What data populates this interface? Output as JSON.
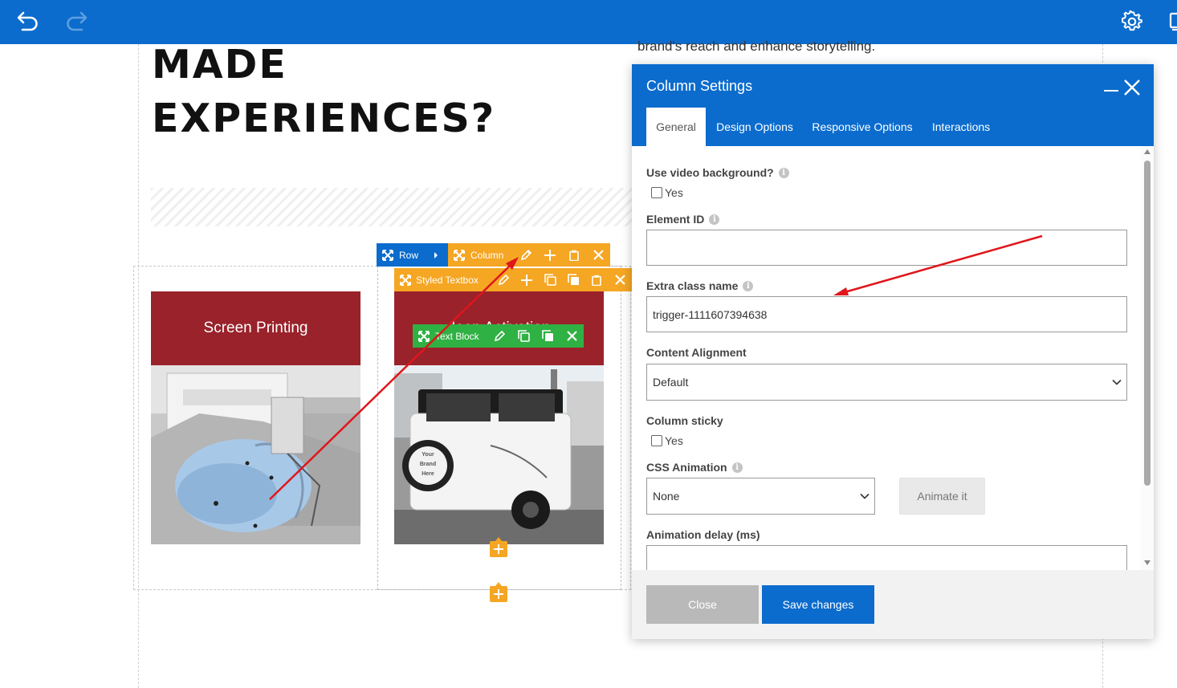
{
  "toolbar": {
    "undo_icon": "undo-icon",
    "redo_icon": "redo-icon",
    "settings_icon": "gear-icon"
  },
  "page": {
    "body_text": "brand's reach and enhance storytelling.",
    "heading_line1": "MADE",
    "heading_line2": "EXPERIENCES?",
    "cards": [
      {
        "title": "Screen Printing"
      },
      {
        "title": "Jeep Activation"
      }
    ],
    "jeep_tire_text": "Your Brand Here"
  },
  "builder": {
    "row_label": "Row",
    "column_label": "Column",
    "styled_textbox_label": "Styled Textbox",
    "text_block_label": "Text Block",
    "colors": {
      "row": "#0b6ccd",
      "column": "#f5a623",
      "text_block": "#2fb143"
    }
  },
  "modal": {
    "title": "Column Settings",
    "tabs": [
      {
        "label": "General",
        "active": true
      },
      {
        "label": "Design Options",
        "active": false
      },
      {
        "label": "Responsive Options",
        "active": false
      },
      {
        "label": "Interactions",
        "active": false
      }
    ],
    "fields": {
      "video_bg_label": "Use video background?",
      "video_bg_option": "Yes",
      "element_id_label": "Element ID",
      "element_id_value": "",
      "extra_class_label": "Extra class name",
      "extra_class_value": "trigger-1111607394638",
      "content_alignment_label": "Content Alignment",
      "content_alignment_value": "Default",
      "column_sticky_label": "Column sticky",
      "column_sticky_option": "Yes",
      "css_animation_label": "CSS Animation",
      "css_animation_value": "None",
      "animate_button": "Animate it",
      "animation_delay_label": "Animation delay (ms)",
      "animation_delay_value": ""
    },
    "footer": {
      "close_label": "Close",
      "save_label": "Save changes"
    },
    "colors": {
      "header": "#0b6ccd",
      "save": "#0b6ccd",
      "close": "#b9b9b9"
    }
  },
  "annotation": {
    "arrow_color": "#e0161b"
  }
}
